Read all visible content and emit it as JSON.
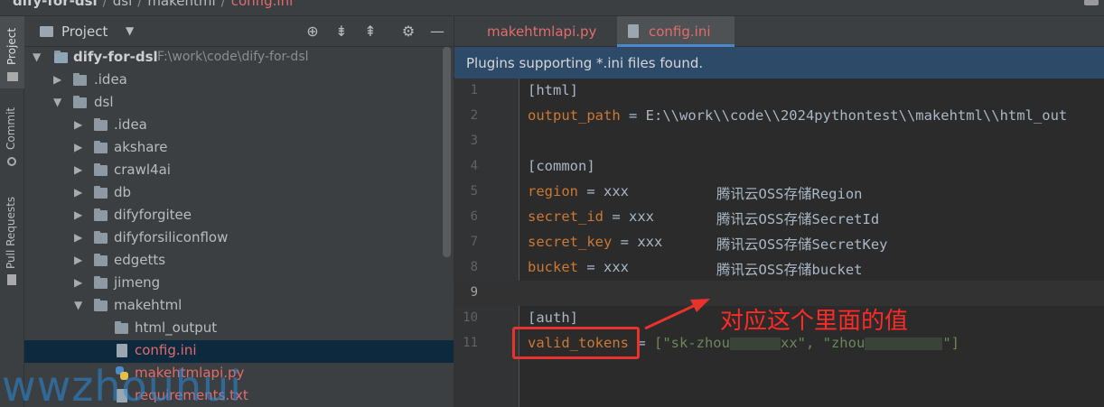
{
  "breadcrumb": {
    "root": "dify-for-dsl",
    "dsl": "dsl",
    "folder": "makehtml",
    "file": "config.ini"
  },
  "tool_strip": {
    "project": "Project",
    "commit": "Commit",
    "pull_requests": "Pull Requests"
  },
  "project_panel": {
    "title": "Project"
  },
  "tree": [
    {
      "label": "dify-for-dsl",
      "path": "F:\\work\\code\\dify-for-dsl",
      "kind": "module"
    },
    {
      "label": ".idea",
      "kind": "folder"
    },
    {
      "label": "dsl",
      "kind": "folder"
    },
    {
      "label": ".idea",
      "kind": "folder"
    },
    {
      "label": "akshare",
      "kind": "folder"
    },
    {
      "label": "crawl4ai",
      "kind": "folder"
    },
    {
      "label": "db",
      "kind": "folder"
    },
    {
      "label": "difyforgitee",
      "kind": "folder"
    },
    {
      "label": "difyforsiliconflow",
      "kind": "folder"
    },
    {
      "label": "edgetts",
      "kind": "folder"
    },
    {
      "label": "jimeng",
      "kind": "folder"
    },
    {
      "label": "makehtml",
      "kind": "folder"
    },
    {
      "label": "html_output",
      "kind": "folder"
    },
    {
      "label": "config.ini",
      "kind": "file"
    },
    {
      "label": "makehtmlapi.py",
      "kind": "python"
    },
    {
      "label": "requirements.txt",
      "kind": "file"
    }
  ],
  "editor_tabs": [
    {
      "label": "makehtmlapi.py",
      "active": false
    },
    {
      "label": "config.ini",
      "active": true
    }
  ],
  "banner": {
    "message": "Plugins supporting *.ini files found."
  },
  "code": {
    "lines": [
      {
        "n": "1",
        "section": "[html]"
      },
      {
        "n": "2",
        "key": "output_path",
        "eq": " = ",
        "value": "E:\\\\work\\\\code\\\\2024pythontest\\\\makehtml\\\\html_out"
      },
      {
        "n": "3"
      },
      {
        "n": "4",
        "section": "[common]"
      },
      {
        "n": "5",
        "key": "region",
        "eq": " = ",
        "value": "xxx",
        "comment": "腾讯云OSS存储Region"
      },
      {
        "n": "6",
        "key": "secret_id",
        "eq": " = ",
        "value": "xxx",
        "comment": "腾讯云OSS存储SecretId"
      },
      {
        "n": "7",
        "key": "secret_key",
        "eq": " = ",
        "value": "xxx",
        "comment": "腾讯云OSS存储SecretKey"
      },
      {
        "n": "8",
        "key": "bucket",
        "eq": " = ",
        "value": "xxx",
        "comment": "腾讯云OSS存储bucket"
      },
      {
        "n": "9"
      },
      {
        "n": "10",
        "section": "[auth]"
      },
      {
        "n": "11",
        "key": "valid_tokens",
        "eq": " = ",
        "value_prefix": "[\"sk-zhou",
        "value_mid": "xx\", \"zhou",
        "value_suffix": "\"]"
      }
    ]
  },
  "annotation": {
    "text": "对应这个里面的值"
  },
  "watermark": {
    "text": "wwzhouhui"
  },
  "colors": {
    "accent": "#4a88c7",
    "annotation": "#e8322d",
    "key": "#cc7832",
    "string": "#6a8759"
  }
}
